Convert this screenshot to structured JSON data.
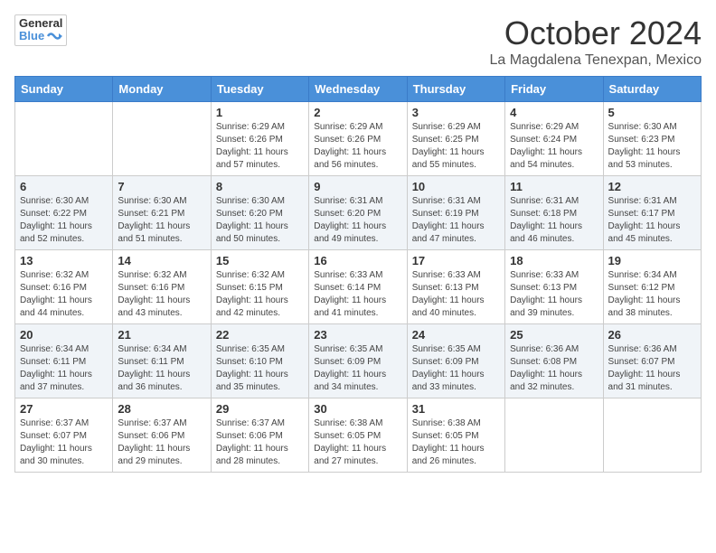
{
  "header": {
    "logo_general": "General",
    "logo_blue": "Blue",
    "month_title": "October 2024",
    "location": "La Magdalena Tenexpan, Mexico"
  },
  "weekdays": [
    "Sunday",
    "Monday",
    "Tuesday",
    "Wednesday",
    "Thursday",
    "Friday",
    "Saturday"
  ],
  "weeks": [
    [
      {
        "day": "",
        "info": ""
      },
      {
        "day": "",
        "info": ""
      },
      {
        "day": "1",
        "info": "Sunrise: 6:29 AM\nSunset: 6:26 PM\nDaylight: 11 hours and 57 minutes."
      },
      {
        "day": "2",
        "info": "Sunrise: 6:29 AM\nSunset: 6:26 PM\nDaylight: 11 hours and 56 minutes."
      },
      {
        "day": "3",
        "info": "Sunrise: 6:29 AM\nSunset: 6:25 PM\nDaylight: 11 hours and 55 minutes."
      },
      {
        "day": "4",
        "info": "Sunrise: 6:29 AM\nSunset: 6:24 PM\nDaylight: 11 hours and 54 minutes."
      },
      {
        "day": "5",
        "info": "Sunrise: 6:30 AM\nSunset: 6:23 PM\nDaylight: 11 hours and 53 minutes."
      }
    ],
    [
      {
        "day": "6",
        "info": "Sunrise: 6:30 AM\nSunset: 6:22 PM\nDaylight: 11 hours and 52 minutes."
      },
      {
        "day": "7",
        "info": "Sunrise: 6:30 AM\nSunset: 6:21 PM\nDaylight: 11 hours and 51 minutes."
      },
      {
        "day": "8",
        "info": "Sunrise: 6:30 AM\nSunset: 6:20 PM\nDaylight: 11 hours and 50 minutes."
      },
      {
        "day": "9",
        "info": "Sunrise: 6:31 AM\nSunset: 6:20 PM\nDaylight: 11 hours and 49 minutes."
      },
      {
        "day": "10",
        "info": "Sunrise: 6:31 AM\nSunset: 6:19 PM\nDaylight: 11 hours and 47 minutes."
      },
      {
        "day": "11",
        "info": "Sunrise: 6:31 AM\nSunset: 6:18 PM\nDaylight: 11 hours and 46 minutes."
      },
      {
        "day": "12",
        "info": "Sunrise: 6:31 AM\nSunset: 6:17 PM\nDaylight: 11 hours and 45 minutes."
      }
    ],
    [
      {
        "day": "13",
        "info": "Sunrise: 6:32 AM\nSunset: 6:16 PM\nDaylight: 11 hours and 44 minutes."
      },
      {
        "day": "14",
        "info": "Sunrise: 6:32 AM\nSunset: 6:16 PM\nDaylight: 11 hours and 43 minutes."
      },
      {
        "day": "15",
        "info": "Sunrise: 6:32 AM\nSunset: 6:15 PM\nDaylight: 11 hours and 42 minutes."
      },
      {
        "day": "16",
        "info": "Sunrise: 6:33 AM\nSunset: 6:14 PM\nDaylight: 11 hours and 41 minutes."
      },
      {
        "day": "17",
        "info": "Sunrise: 6:33 AM\nSunset: 6:13 PM\nDaylight: 11 hours and 40 minutes."
      },
      {
        "day": "18",
        "info": "Sunrise: 6:33 AM\nSunset: 6:13 PM\nDaylight: 11 hours and 39 minutes."
      },
      {
        "day": "19",
        "info": "Sunrise: 6:34 AM\nSunset: 6:12 PM\nDaylight: 11 hours and 38 minutes."
      }
    ],
    [
      {
        "day": "20",
        "info": "Sunrise: 6:34 AM\nSunset: 6:11 PM\nDaylight: 11 hours and 37 minutes."
      },
      {
        "day": "21",
        "info": "Sunrise: 6:34 AM\nSunset: 6:11 PM\nDaylight: 11 hours and 36 minutes."
      },
      {
        "day": "22",
        "info": "Sunrise: 6:35 AM\nSunset: 6:10 PM\nDaylight: 11 hours and 35 minutes."
      },
      {
        "day": "23",
        "info": "Sunrise: 6:35 AM\nSunset: 6:09 PM\nDaylight: 11 hours and 34 minutes."
      },
      {
        "day": "24",
        "info": "Sunrise: 6:35 AM\nSunset: 6:09 PM\nDaylight: 11 hours and 33 minutes."
      },
      {
        "day": "25",
        "info": "Sunrise: 6:36 AM\nSunset: 6:08 PM\nDaylight: 11 hours and 32 minutes."
      },
      {
        "day": "26",
        "info": "Sunrise: 6:36 AM\nSunset: 6:07 PM\nDaylight: 11 hours and 31 minutes."
      }
    ],
    [
      {
        "day": "27",
        "info": "Sunrise: 6:37 AM\nSunset: 6:07 PM\nDaylight: 11 hours and 30 minutes."
      },
      {
        "day": "28",
        "info": "Sunrise: 6:37 AM\nSunset: 6:06 PM\nDaylight: 11 hours and 29 minutes."
      },
      {
        "day": "29",
        "info": "Sunrise: 6:37 AM\nSunset: 6:06 PM\nDaylight: 11 hours and 28 minutes."
      },
      {
        "day": "30",
        "info": "Sunrise: 6:38 AM\nSunset: 6:05 PM\nDaylight: 11 hours and 27 minutes."
      },
      {
        "day": "31",
        "info": "Sunrise: 6:38 AM\nSunset: 6:05 PM\nDaylight: 11 hours and 26 minutes."
      },
      {
        "day": "",
        "info": ""
      },
      {
        "day": "",
        "info": ""
      }
    ]
  ]
}
